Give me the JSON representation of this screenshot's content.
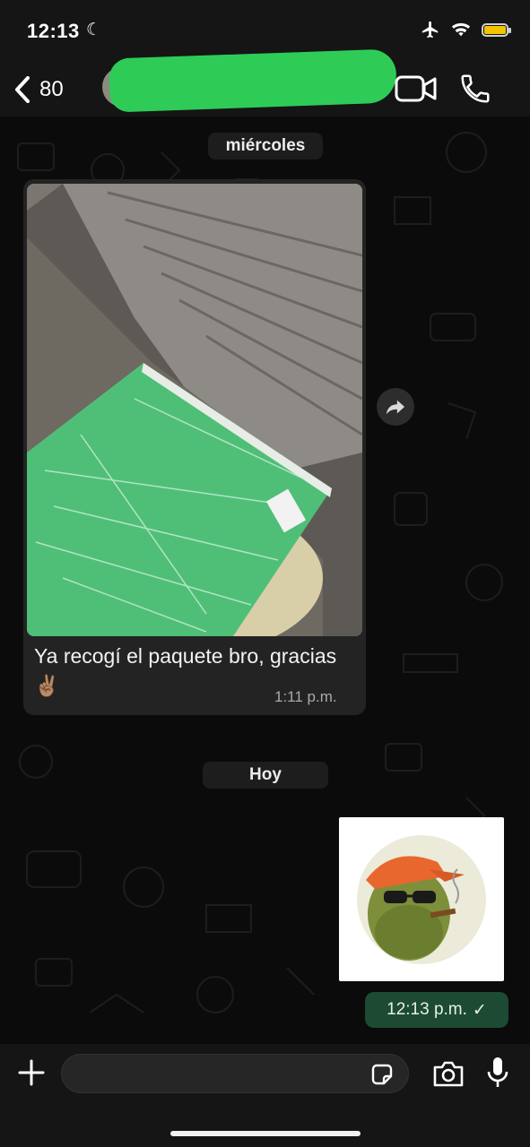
{
  "status_bar": {
    "time": "12:13",
    "moon_icon": "moon-icon",
    "icons": [
      "airplane-icon",
      "wifi-icon",
      "battery-icon"
    ]
  },
  "header": {
    "back_count": "80",
    "icons": [
      "chevron-left-icon",
      "video-call-icon",
      "phone-icon"
    ]
  },
  "chat": {
    "date_separator_1": "miércoles",
    "incoming_message": {
      "text": "Ya recogí el paquete bro, gracias ✌🏽",
      "time": "1:11 p.m."
    },
    "date_separator_2": "Hoy",
    "outgoing_message": {
      "type": "sticker",
      "time": "12:13 p.m.",
      "status": "✓"
    }
  },
  "input_bar": {
    "placeholder": "",
    "icons": [
      "plus-icon",
      "sticker-icon",
      "camera-icon",
      "microphone-icon"
    ]
  },
  "colors": {
    "background": "#0b0b0b",
    "bar": "#151515",
    "incoming_bubble": "#232323",
    "outgoing_bubble": "#1d4a33",
    "battery": "#f5c400",
    "redaction": "#2ecc57"
  }
}
